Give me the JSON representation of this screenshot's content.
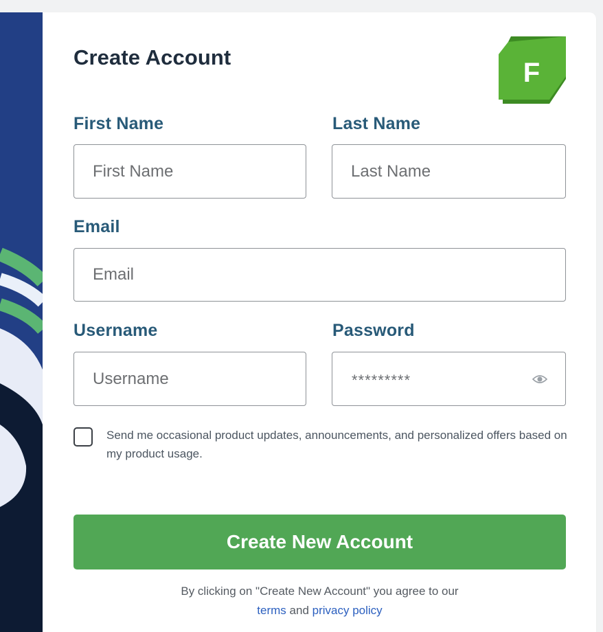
{
  "form": {
    "title": "Create Account",
    "logo_letter": "F"
  },
  "fields": {
    "first_name": {
      "label": "First Name",
      "placeholder": "First Name"
    },
    "last_name": {
      "label": "Last Name",
      "placeholder": "Last Name"
    },
    "email": {
      "label": "Email",
      "placeholder": "Email"
    },
    "username": {
      "label": "Username",
      "placeholder": "Username"
    },
    "password": {
      "label": "Password",
      "value": "*********",
      "toggle_icon": "eye-icon"
    }
  },
  "consent": {
    "checked": false,
    "text": "Send me occasional product updates, announcements, and personalized offers based on my product usage."
  },
  "actions": {
    "submit_label": "Create New Account"
  },
  "legal": {
    "prefix": "By clicking on \"Create New Account\" you agree to our",
    "terms_label": "terms",
    "and_label": "and",
    "privacy_label": "privacy policy"
  },
  "colors": {
    "side_panel": "#223f85",
    "accent_green": "#51a755",
    "label_color": "#285a78",
    "link_color": "#2b5fbf"
  }
}
